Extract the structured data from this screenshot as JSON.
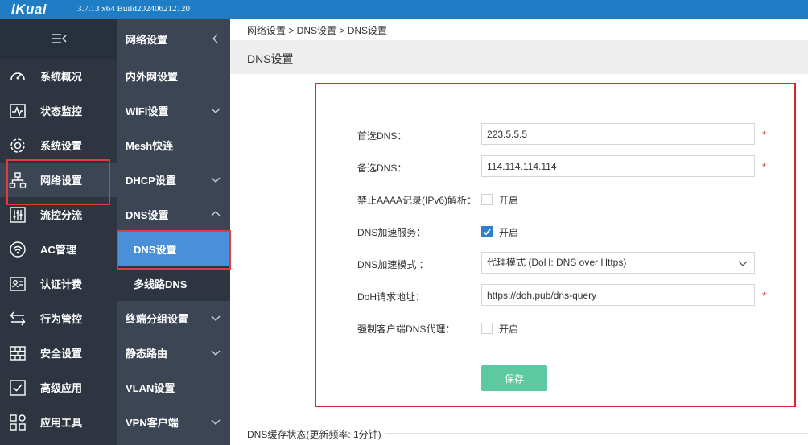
{
  "app": {
    "logo": "iKuai",
    "version": "3.7.13 x64 Build202406212120"
  },
  "sidebar": {
    "items": [
      {
        "label": "系统概况",
        "icon": "gauge-icon"
      },
      {
        "label": "状态监控",
        "icon": "pulse-chart-icon"
      },
      {
        "label": "系统设置",
        "icon": "gear-icon"
      },
      {
        "label": "网络设置",
        "icon": "network-tree-icon",
        "active": true
      },
      {
        "label": "流控分流",
        "icon": "sliders-icon"
      },
      {
        "label": "AC管理",
        "icon": "wifi-ap-icon"
      },
      {
        "label": "认证计费",
        "icon": "id-card-icon"
      },
      {
        "label": "行为管控",
        "icon": "swap-arrows-icon"
      },
      {
        "label": "安全设置",
        "icon": "firewall-icon"
      },
      {
        "label": "高级应用",
        "icon": "checklist-icon"
      },
      {
        "label": "应用工具",
        "icon": "apps-grid-icon"
      }
    ]
  },
  "submenu": {
    "title": "网络设置",
    "items": [
      {
        "label": "内外网设置"
      },
      {
        "label": "WiFi设置",
        "chevron": "down"
      },
      {
        "label": "Mesh快连"
      },
      {
        "label": "DHCP设置",
        "chevron": "down"
      },
      {
        "label": "DNS设置",
        "chevron": "up"
      },
      {
        "label": "终端分组设置",
        "chevron": "down"
      },
      {
        "label": "静态路由",
        "chevron": "down"
      },
      {
        "label": "VLAN设置"
      },
      {
        "label": "VPN客户端",
        "chevron": "down"
      }
    ],
    "dns_children": [
      {
        "label": "DNS设置",
        "active": true
      },
      {
        "label": "多线路DNS"
      }
    ]
  },
  "breadcrumb": "网络设置 > DNS设置 > DNS设置",
  "page_title": "DNS设置",
  "form": {
    "primary_dns_label": "首选DNS：",
    "primary_dns_value": "223.5.5.5",
    "secondary_dns_label": "备选DNS：",
    "secondary_dns_value": "114.114.114.114",
    "block_aaaa_label": "禁止AAAA记录(IPv6)解析：",
    "block_aaaa_checked": false,
    "dns_accel_label": "DNS加速服务：",
    "dns_accel_checked": true,
    "accel_mode_label": "DNS加速模式 ：",
    "accel_mode_value": "代理模式 (DoH: DNS over Https)",
    "doh_label": "DoH请求地址：",
    "doh_value": "https://doh.pub/dns-query",
    "force_proxy_label": "强制客户端DNS代理：",
    "force_proxy_checked": false,
    "enable_text": "开启",
    "required_mark": "*",
    "save_label": "保存"
  },
  "cache_status_title": "DNS缓存状态(更新频率: 1分钟)",
  "colors": {
    "topbar": "#1f7dc5",
    "sidebar": "#2e3541",
    "submenu": "#3b4554",
    "active_sub": "#4a90d9",
    "highlight_box": "#e23b3b",
    "save_button": "#5cc9a0",
    "checkbox_on": "#2f7fd1"
  }
}
